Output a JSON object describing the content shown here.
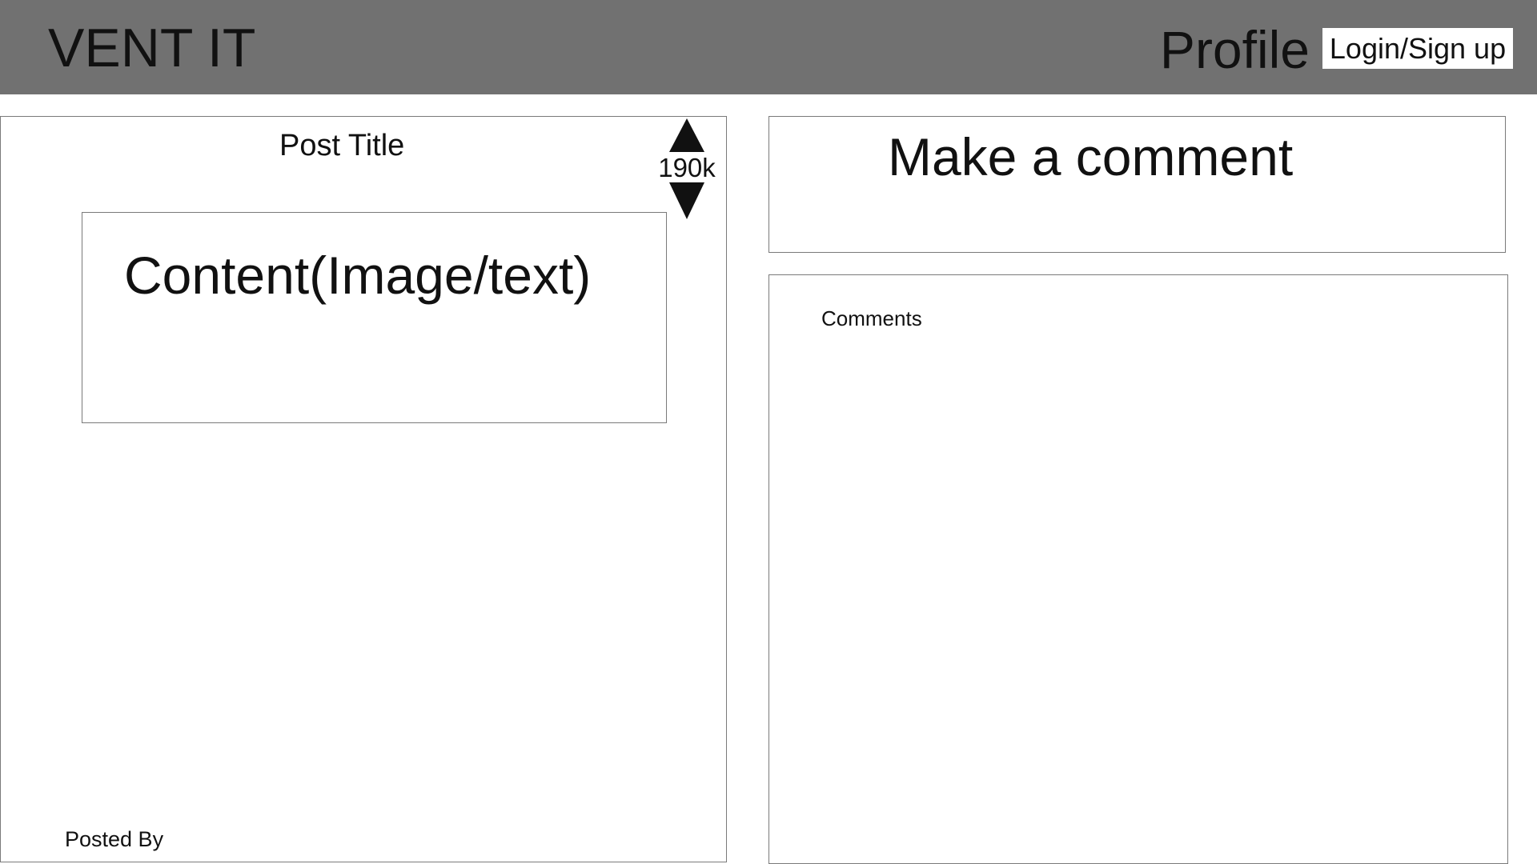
{
  "header": {
    "logo": "VENT IT",
    "profile_label": "Profile",
    "login_label": "Login/Sign up"
  },
  "post": {
    "title": "Post Title",
    "vote_count": "190k",
    "content": "Content(Image/text)",
    "posted_by": "Posted By"
  },
  "comment_input": {
    "placeholder": "Make a comment"
  },
  "comments": {
    "heading": "Comments"
  },
  "colors": {
    "header_background": "#717171",
    "border": "#7a7a7a",
    "text": "#111111"
  },
  "icons": {
    "upvote": "triangle-up-icon",
    "downvote": "triangle-down-icon"
  }
}
